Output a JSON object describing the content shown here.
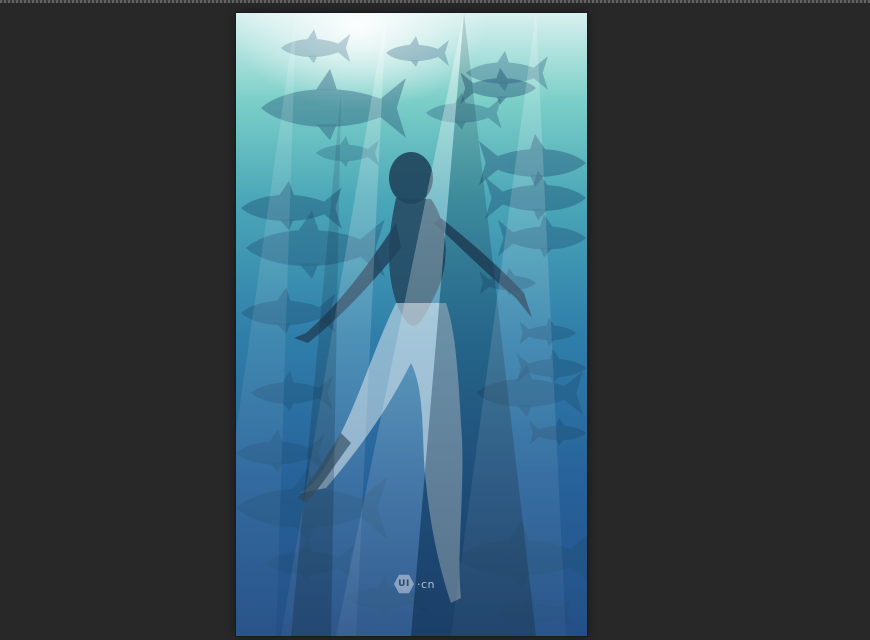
{
  "canvas": {
    "watermark_mark": "UI",
    "watermark_suffix": "·cn"
  },
  "colors": {
    "workspace_bg": "#282828",
    "water_light": "#7ccfc8",
    "water_deep": "#244f86",
    "fish": "#1e4e73"
  }
}
